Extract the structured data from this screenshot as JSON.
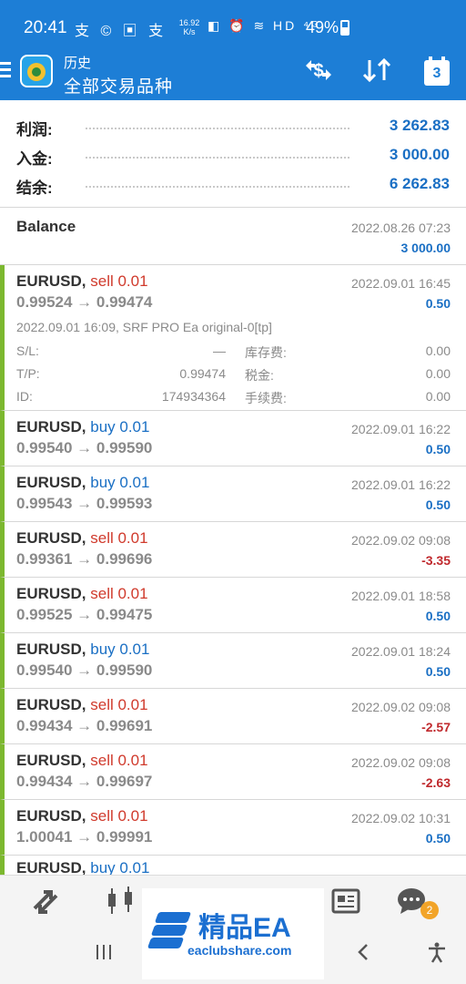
{
  "status_bar": {
    "time": "20:41",
    "notif_icons": "支 © ▣ 支",
    "net_speed_value": "16.92",
    "net_speed_unit": "K/s",
    "sys_icons": "◧ ⏰ ≋ HD ⁴ᴳ",
    "battery": "49%"
  },
  "app_bar": {
    "subtitle": "历史",
    "title": "全部交易品种",
    "calendar_day": "3"
  },
  "summary": [
    {
      "label": "利润:",
      "value": "3 262.83"
    },
    {
      "label": "入金:",
      "value": "3 000.00"
    },
    {
      "label": "结余:",
      "value": "6 262.83"
    }
  ],
  "balance": {
    "title": "Balance",
    "time": "2022.08.26 07:23",
    "amount": "3 000.00"
  },
  "expanded": {
    "comment": "2022.09.01 16:09, SRF PRO Ea original-0[tp]",
    "sl_label": "S/L:",
    "sl_value": "—",
    "tp_label": "T/P:",
    "tp_value": "0.99474",
    "id_label": "ID:",
    "id_value": "174934364",
    "swap_label": "库存费:",
    "swap_value": "0.00",
    "tax_label": "税金:",
    "tax_value": "0.00",
    "fee_label": "手续费:",
    "fee_value": "0.00"
  },
  "deals": [
    {
      "symbol": "EURUSD,",
      "dir": "sell 0.01",
      "prices": "0.99524 → 0.99474",
      "time": "2022.09.01 16:45",
      "profit": "0.50"
    },
    {
      "symbol": "EURUSD,",
      "dir": "buy 0.01",
      "prices": "0.99540 → 0.99590",
      "time": "2022.09.01 16:22",
      "profit": "0.50"
    },
    {
      "symbol": "EURUSD,",
      "dir": "buy 0.01",
      "prices": "0.99543 → 0.99593",
      "time": "2022.09.01 16:22",
      "profit": "0.50"
    },
    {
      "symbol": "EURUSD,",
      "dir": "sell 0.01",
      "prices": "0.99361 → 0.99696",
      "time": "2022.09.02 09:08",
      "profit": "-3.35"
    },
    {
      "symbol": "EURUSD,",
      "dir": "sell 0.01",
      "prices": "0.99525 → 0.99475",
      "time": "2022.09.01 18:58",
      "profit": "0.50"
    },
    {
      "symbol": "EURUSD,",
      "dir": "buy 0.01",
      "prices": "0.99540 → 0.99590",
      "time": "2022.09.01 18:24",
      "profit": "0.50"
    },
    {
      "symbol": "EURUSD,",
      "dir": "sell 0.01",
      "prices": "0.99434 → 0.99691",
      "time": "2022.09.02 09:08",
      "profit": "-2.57"
    },
    {
      "symbol": "EURUSD,",
      "dir": "sell 0.01",
      "prices": "0.99434 → 0.99697",
      "time": "2022.09.02 09:08",
      "profit": "-2.63"
    },
    {
      "symbol": "EURUSD,",
      "dir": "sell 0.01",
      "prices": "1.00041 → 0.99991",
      "time": "2022.09.02 10:31",
      "profit": "0.50"
    },
    {
      "symbol": "EURUSD,",
      "dir": "buy 0.01"
    }
  ],
  "bottom_nav": {
    "chat_badge": "2"
  },
  "watermark": {
    "title": "精品EA",
    "url": "eaclubshare.com"
  },
  "colors": {
    "app_bar": "#1d7ed6",
    "buy": "#1a6fc4",
    "sell": "#d03a2c",
    "loss": "#c0292d",
    "trade_bar": "#7cb82f"
  }
}
